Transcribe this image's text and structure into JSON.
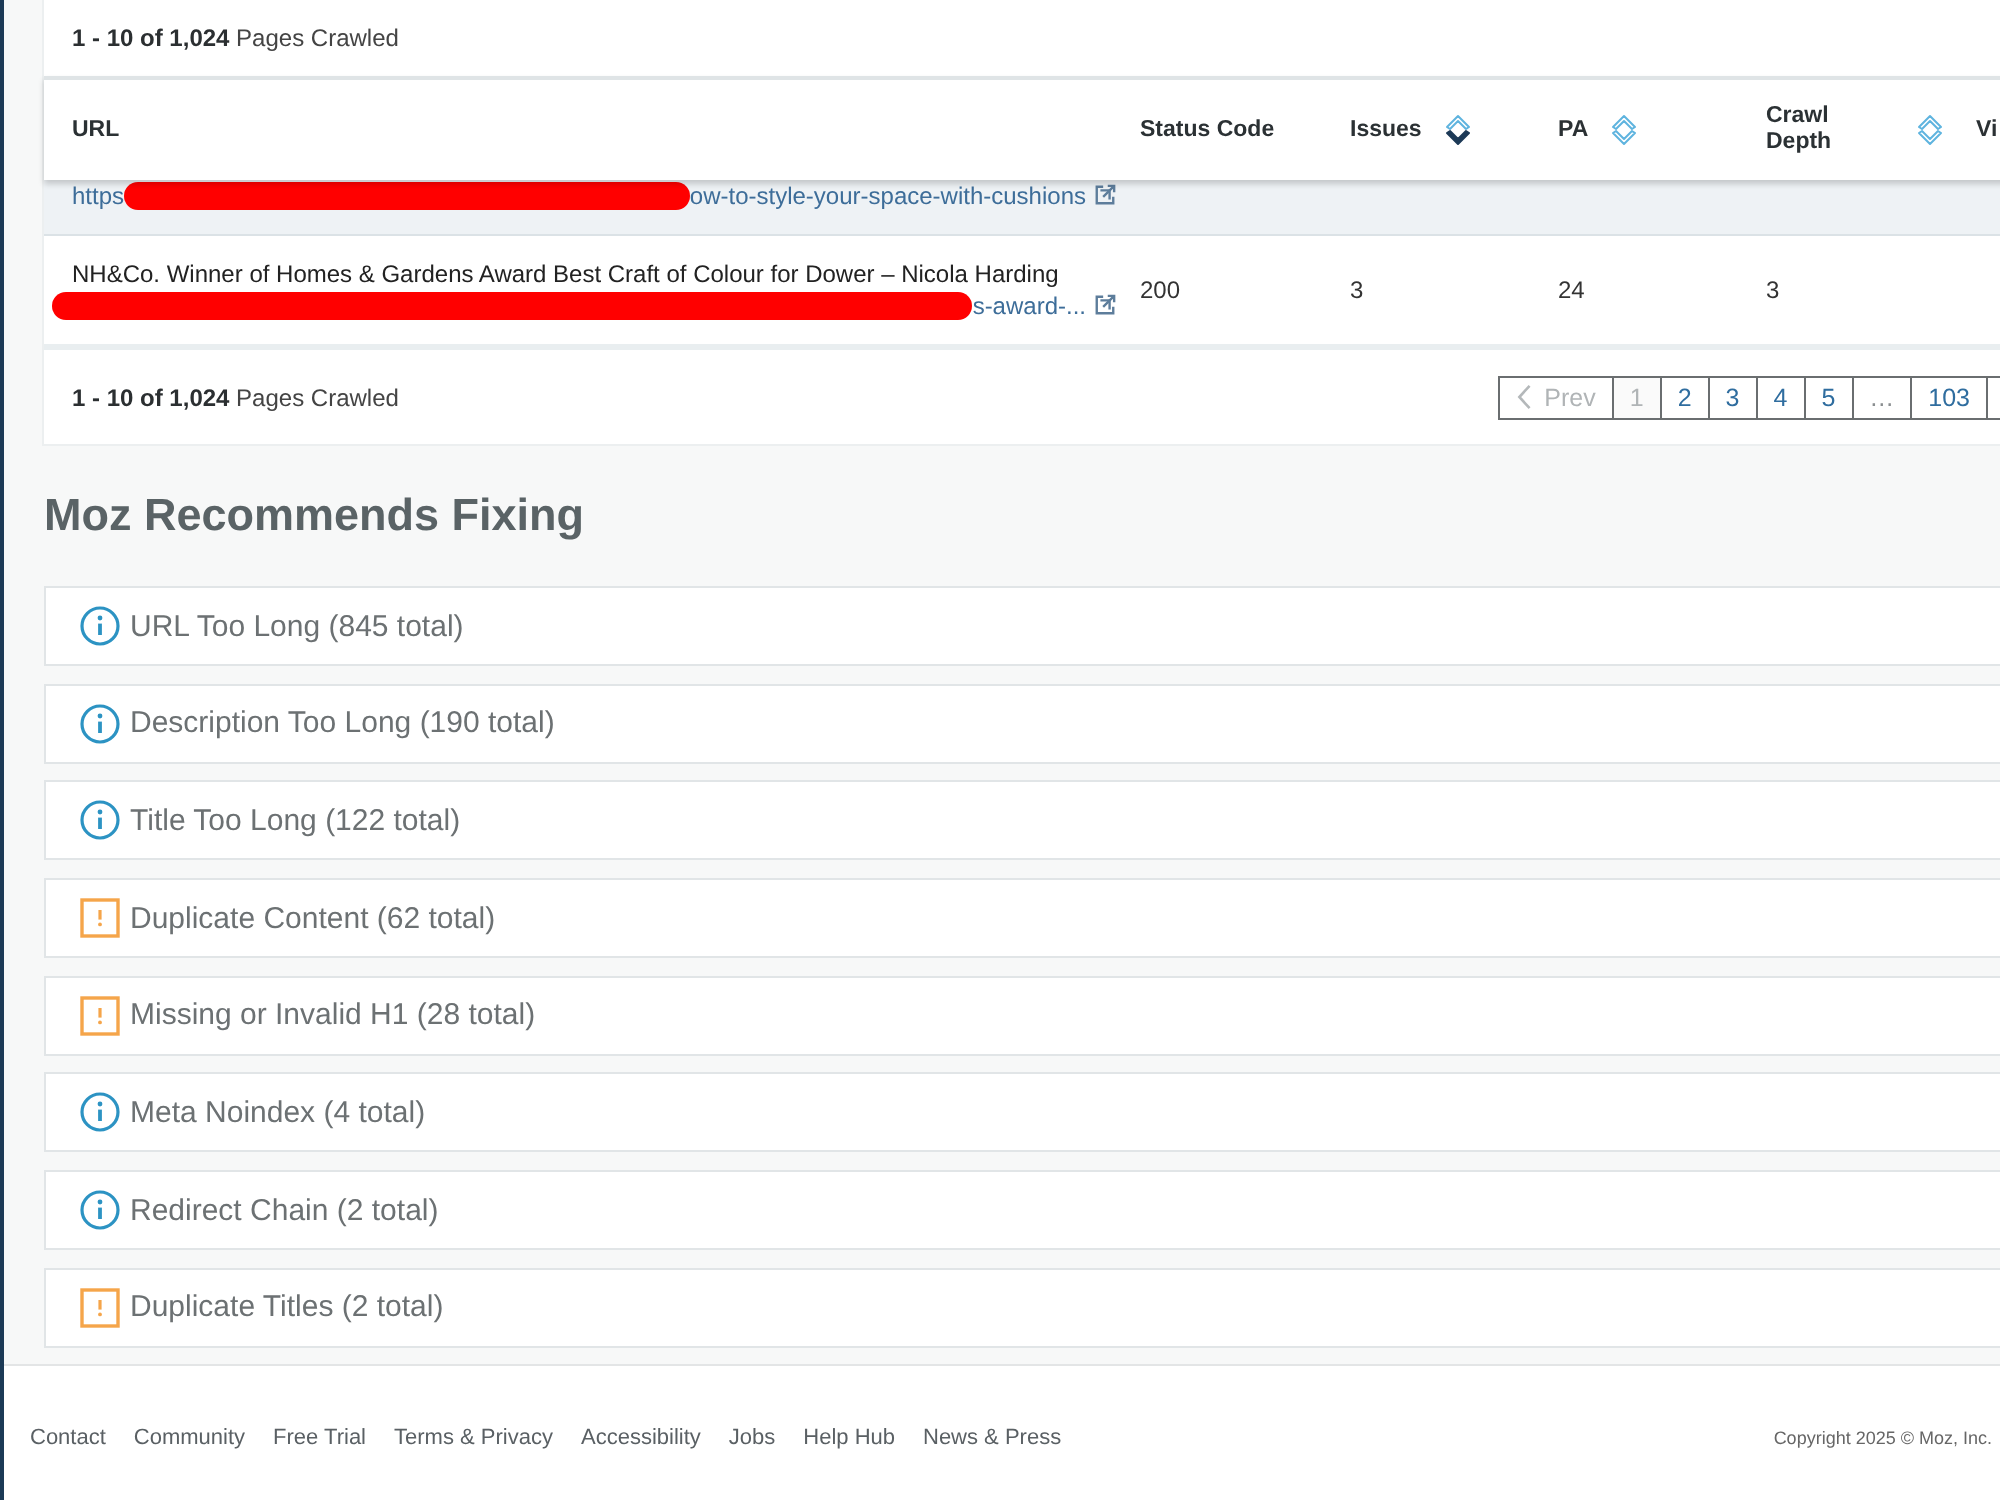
{
  "table": {
    "summary": "**1 - 10 of 1,024** Pages Crawled",
    "columns": [
      {
        "label": "URL",
        "sortable": false
      },
      {
        "label": "Status Code",
        "sortable": false
      },
      {
        "label": "Issues",
        "sortable": true,
        "sorted_descending": true
      },
      {
        "label": "PA",
        "sortable": true,
        "sorted_descending": false
      },
      {
        "label": "Crawl Depth",
        "sortable": true,
        "sorted_descending": false
      },
      {
        "label": "Vi",
        "sortable": false
      }
    ],
    "rows": [
      {
        "highlighted": true,
        "url_start": "https",
        "redacted": true,
        "url_end": "ow-to-style-your-space-with-cushions"
      },
      {
        "highlighted": false,
        "title": "NH&Co. Winner of Homes & Gardens Award Best Craft of Colour for Dower – Nicola Harding",
        "redacted": true,
        "url_end": "s-award-...",
        "status_code": "200",
        "issues": "3",
        "pa": "24",
        "crawl_depth": "3"
      }
    ],
    "footer_summary": "**1 - 10 of 1,024** Pages Crawled",
    "pagination": {
      "prev": {
        "label": "Prev",
        "disabled": true
      },
      "pages": [
        {
          "label": "1",
          "kind": "page",
          "selected": true
        },
        {
          "label": "2",
          "kind": "page",
          "selected": false
        },
        {
          "label": "3",
          "kind": "page",
          "selected": false
        },
        {
          "label": "4",
          "kind": "page",
          "selected": false
        },
        {
          "label": "5",
          "kind": "page",
          "selected": false
        },
        {
          "label": "…",
          "kind": "ellipsis",
          "selected": false
        },
        {
          "label": "103",
          "kind": "page",
          "selected": false
        }
      ]
    }
  },
  "recommendations": {
    "title": "Moz Recommends Fixing",
    "items": [
      {
        "label": "URL Too Long (845 total)",
        "kind": "info"
      },
      {
        "label": "Description Too Long (190 total)",
        "kind": "info"
      },
      {
        "label": "Title Too Long (122 total)",
        "kind": "info"
      },
      {
        "label": "Duplicate Content (62 total)",
        "kind": "warning"
      },
      {
        "label": "Missing or Invalid H1 (28 total)",
        "kind": "warning"
      },
      {
        "label": "Meta Noindex (4 total)",
        "kind": "info"
      },
      {
        "label": "Redirect Chain (2 total)",
        "kind": "info"
      },
      {
        "label": "Duplicate Titles (2 total)",
        "kind": "warning"
      }
    ]
  },
  "footer": {
    "links": [
      "Contact",
      "Community",
      "Free Trial",
      "Terms & Privacy",
      "Accessibility",
      "Jobs",
      "Help Hub",
      "News & Press"
    ],
    "copyright": "Copyright 2025 © Moz, Inc."
  }
}
